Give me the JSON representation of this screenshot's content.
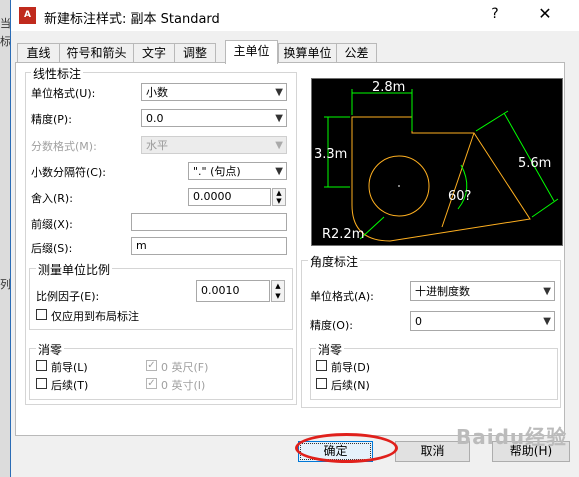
{
  "background_window": {
    "lines": [
      "当",
      "标",
      "列"
    ]
  },
  "window": {
    "title": "新建标注样式: 副本 Standard",
    "app_icon_text": "A",
    "help_glyph": "?",
    "close_glyph": "✕"
  },
  "tabs": [
    {
      "label": "直线"
    },
    {
      "label": "符号和箭头"
    },
    {
      "label": "文字"
    },
    {
      "label": "调整"
    },
    {
      "label": "主单位",
      "active": true
    },
    {
      "label": "换算单位"
    },
    {
      "label": "公差"
    }
  ],
  "linear": {
    "title": "线性标注",
    "unit_format_label": "单位格式(U):",
    "unit_format_value": "小数",
    "precision_label": "精度(P):",
    "precision_value": "0.0",
    "fraction_label": "分数格式(M):",
    "fraction_value": "水平",
    "decimal_sep_label": "小数分隔符(C):",
    "decimal_sep_value": "\".\" (句点)",
    "roundoff_label": "舍入(R):",
    "roundoff_value": "0.0000",
    "prefix_label": "前缀(X):",
    "prefix_value": "",
    "suffix_label": "后缀(S):",
    "suffix_value": "m"
  },
  "scale": {
    "title": "测量单位比例",
    "factor_label": "比例因子(E):",
    "factor_value": "0.0010",
    "layout_only_label": "仅应用到布局标注"
  },
  "zero_left": {
    "title": "消零",
    "leading_label": "前导(L)",
    "trailing_label": "后续(T)",
    "feet_label": "0 英尺(F)",
    "inches_label": "0 英寸(I)"
  },
  "angular": {
    "title": "角度标注",
    "unit_format_label": "单位格式(A):",
    "unit_format_value": "十进制度数",
    "precision_label": "精度(O):",
    "precision_value": "0"
  },
  "zero_right": {
    "title": "消零",
    "leading_label": "前导(D)",
    "trailing_label": "后续(N)"
  },
  "preview_labels": {
    "top": "2.8m",
    "left": "3.3m",
    "right": "5.6m",
    "angle": "60?",
    "radius": "R2.2m"
  },
  "colors": {
    "preview_bg": "#000000",
    "dim_green": "#00ff00",
    "geometry_orange": "#ffb020",
    "highlight_red": "#e0201b"
  },
  "buttons": {
    "ok": "确定",
    "cancel": "取消",
    "help": "帮助(H)"
  },
  "watermark": "Baidu经验"
}
